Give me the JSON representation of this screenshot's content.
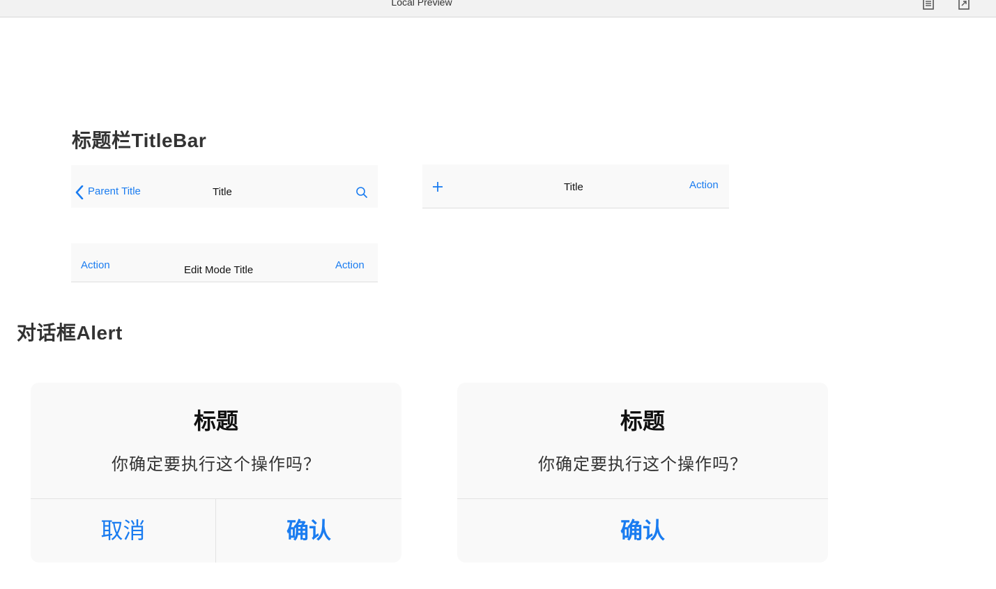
{
  "window": {
    "title": "Local Preview",
    "icons": [
      "document-icon",
      "export-icon"
    ]
  },
  "titlebar_section": {
    "heading": "标题栏TitleBar",
    "bar1": {
      "back_label": "Parent Title",
      "title": "Title",
      "right_icon": "search-icon"
    },
    "bar2": {
      "left_icon": "plus-icon",
      "title": "Title",
      "action": "Action"
    },
    "bar3": {
      "left_action": "Action",
      "title": "Edit Mode Title",
      "right_action": "Action"
    }
  },
  "alert_section": {
    "heading": "对话框Alert",
    "alert1": {
      "title": "标题",
      "message": "你确定要执行这个操作吗？",
      "cancel": "取消",
      "confirm": "确认"
    },
    "alert2": {
      "title": "标题",
      "message": "你确定要执行这个操作吗？",
      "confirm": "确认"
    }
  },
  "colors": {
    "accent": "#1a7cf0",
    "bar_bg": "#f9f9f9",
    "divider": "#dedede"
  }
}
